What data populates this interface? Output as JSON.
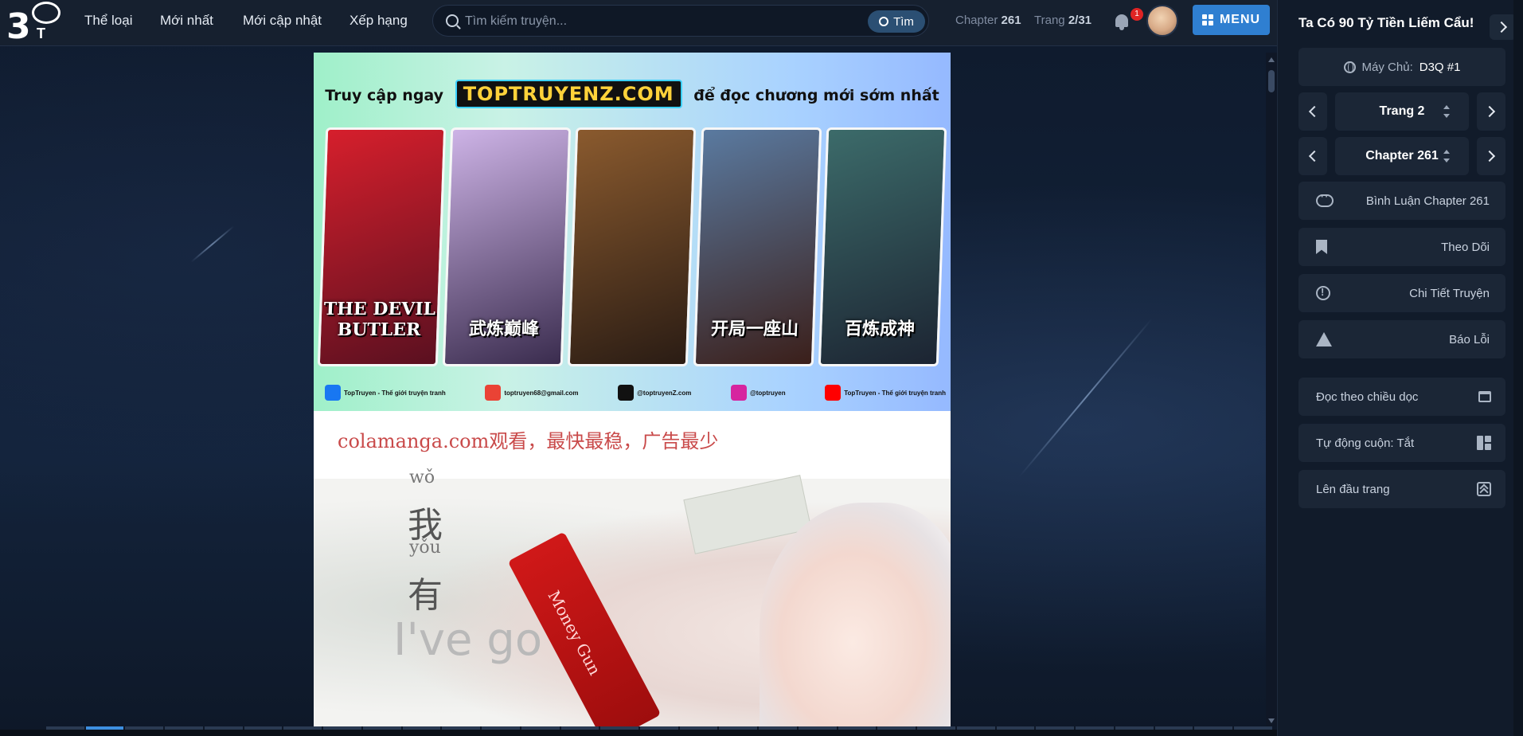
{
  "header": {
    "logo_text": "3",
    "logo_sub": "T",
    "nav": [
      "Thể loại",
      "Mới nhất",
      "Mới cập nhật",
      "Xếp hạng"
    ],
    "search": {
      "placeholder": "Tìm kiếm truyện...",
      "value": "",
      "button": "Tìm"
    },
    "chapter_label": "Chapter",
    "chapter_value": "261",
    "page_label": "Trang",
    "page_value": "2/31",
    "notification_count": "1",
    "menu_label": "MENU"
  },
  "reader": {
    "ad_headline_pre": "Truy cập ngay",
    "ad_brand": "TOPTRUYENZ.COM",
    "ad_headline_post": "để đọc chương mới sớm nhất",
    "ad_cards": [
      {
        "title": "THE DEVIL BUTLER",
        "color_a": "#d61f2c",
        "color_b": "#5a1020"
      },
      {
        "title": "武炼巅峰",
        "color_a": "#cdb3e6",
        "color_b": "#3a2c4e"
      },
      {
        "title": "",
        "color_a": "#8a5a2e",
        "color_b": "#2a1c14"
      },
      {
        "title": "开局一座山",
        "color_a": "#5a7aa0",
        "color_b": "#3b1f1a"
      },
      {
        "title": "百炼成神",
        "color_a": "#3c6b6a",
        "color_b": "#1c2432"
      }
    ],
    "ad_socials": [
      {
        "label": "TopTruyen - Thế giới truyện tranh",
        "color": "#1877f2"
      },
      {
        "label": "toptruyen68@gmail.com",
        "color": "#ea4335"
      },
      {
        "label": "@toptruyenZ.com",
        "color": "#111111"
      },
      {
        "label": "@toptruyen",
        "color": "#d6249f"
      },
      {
        "label": "TopTruyen - Thế giới truyện tranh",
        "color": "#ff0000"
      }
    ],
    "watermark": "colamanga.com观看，最快最稳，广告最少",
    "art_pinyin_1": "wǒ",
    "art_han_1": "我",
    "art_pinyin_2": "yǒu",
    "art_han_2": "有",
    "art_english": "I've go",
    "art_gun_text": "Money Gun",
    "progress_total": 31,
    "progress_current": 2
  },
  "sidebar": {
    "title": "Ta Có 90 Tỷ Tiền Liếm Cẩu!",
    "server_label": "Máy Chủ:",
    "server_value": "D3Q #1",
    "page_select": "Trang 2",
    "chapter_select": "Chapter 261",
    "actions": [
      {
        "label": "Bình Luận Chapter 261",
        "icon": "comment-icon"
      },
      {
        "label": "Theo Dõi",
        "icon": "bookmark-icon"
      },
      {
        "label": "Chi Tiết Truyện",
        "icon": "info-icon"
      },
      {
        "label": "Báo Lỗi",
        "icon": "warning-icon"
      }
    ],
    "settings": [
      {
        "label": "Đọc theo chiều dọc",
        "icon": "window-icon"
      },
      {
        "label": "Tự động cuộn: Tắt",
        "icon": "layout-icon"
      },
      {
        "label": "Lên đầu trang",
        "icon": "scroll-top-icon"
      }
    ]
  },
  "colors": {
    "accent": "#2f7fd1",
    "header_bg": "#16202f",
    "sidebar_bg": "#111b2a",
    "badge": "#e02424"
  }
}
